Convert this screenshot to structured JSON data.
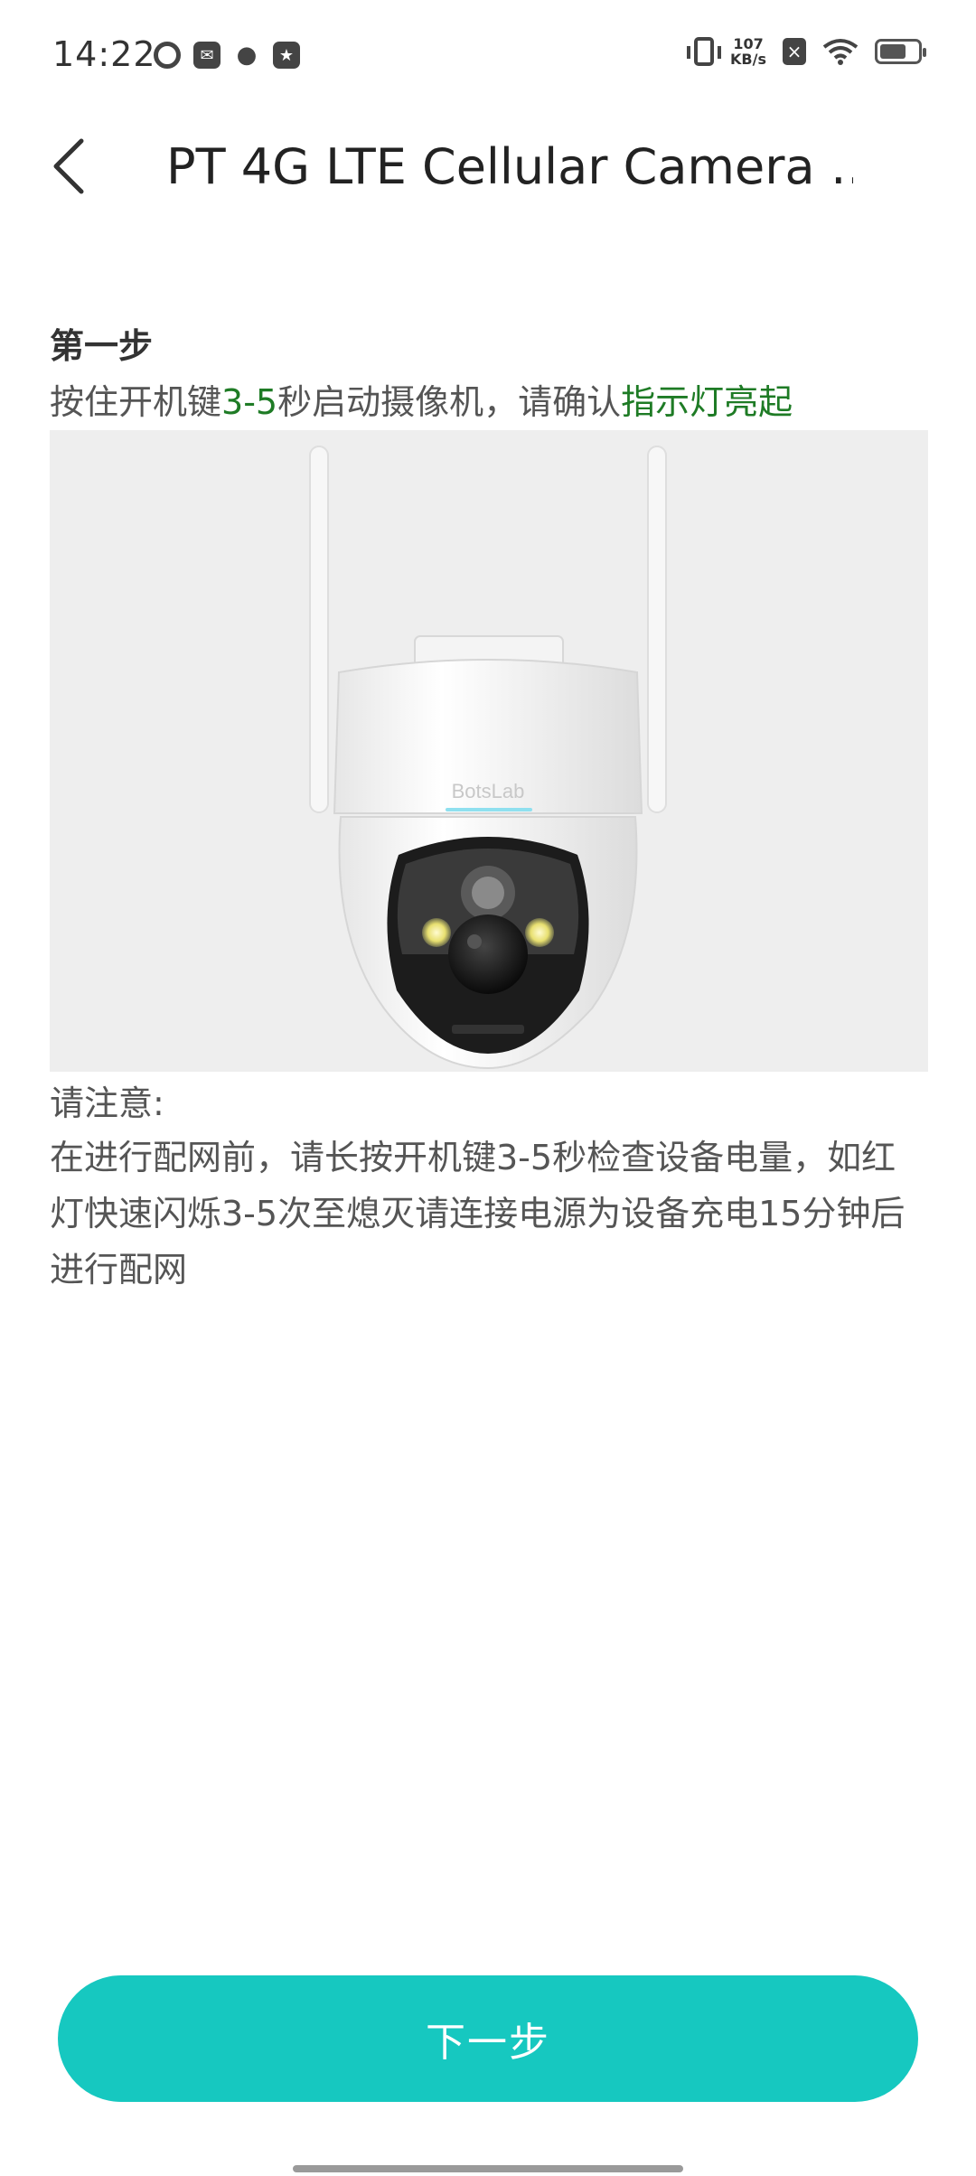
{
  "status_bar": {
    "time": "14:22",
    "speed_value": "107",
    "speed_unit": "KB/s",
    "icons_left": [
      "sync-icon",
      "message-icon",
      "wechat-icon",
      "star-icon"
    ],
    "icons_right": [
      "vibrate-icon",
      "network-speed",
      "no-sim-icon",
      "wifi-icon",
      "battery-icon"
    ]
  },
  "header": {
    "title": "PT 4G LTE Cellular Camera …"
  },
  "step": {
    "title": "第一步",
    "desc_part1": "按住开机键",
    "desc_highlight1": "3-5",
    "desc_part2": "秒启动摄像机，请确认",
    "desc_highlight2": "指示灯亮起"
  },
  "camera": {
    "brand_text": "BotsLab"
  },
  "note": {
    "title": "请注意:",
    "body": "在进行配网前，请长按开机键3-5秒检查设备电量，如红灯快速闪烁3-5次至熄灭请连接电源为设备充电15分钟后进行配网"
  },
  "footer": {
    "next_label": "下一步"
  },
  "colors": {
    "accent": "#16c8c0",
    "highlight_green": "#1e7b25"
  }
}
